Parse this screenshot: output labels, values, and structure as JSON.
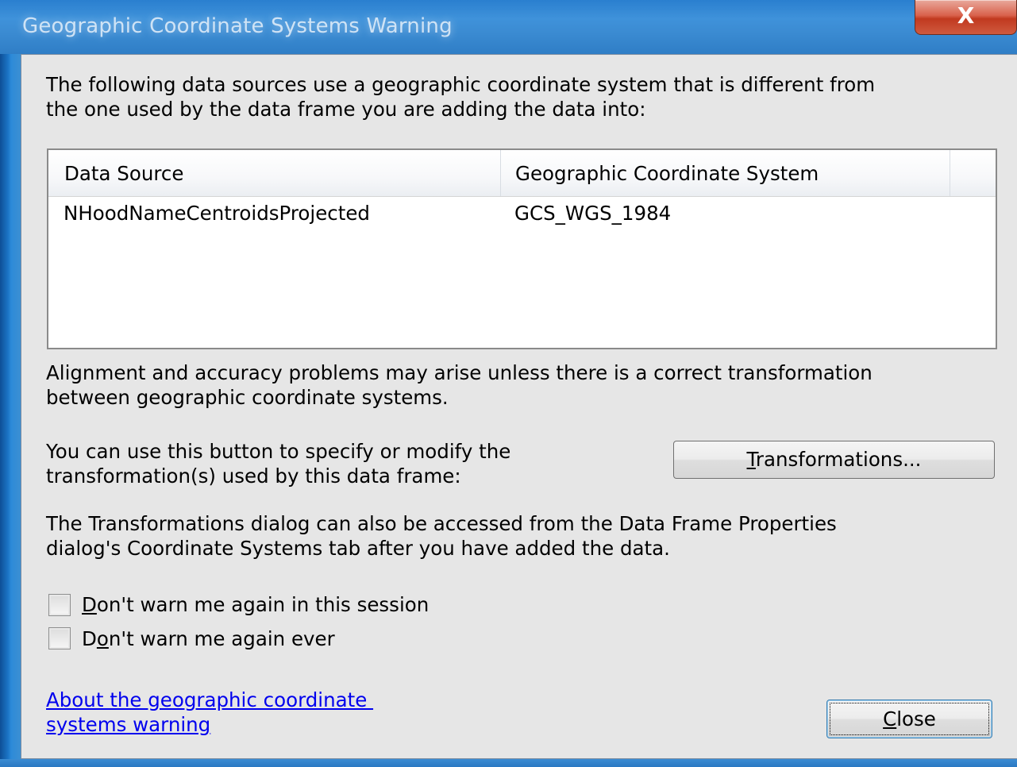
{
  "window": {
    "title": "Geographic Coordinate Systems Warning",
    "close_glyph": "X"
  },
  "intro": {
    "line1": "The following data sources use a geographic coordinate system that is different from",
    "line2": "the one used by the data frame you are adding the data into:"
  },
  "table": {
    "columns": [
      "Data Source",
      "Geographic Coordinate System"
    ],
    "rows": [
      {
        "data_source": "NHoodNameCentroidsProjected",
        "gcs": "GCS_WGS_1984"
      }
    ]
  },
  "alignment": {
    "line1": "Alignment and accuracy problems may arise unless there is a correct transformation",
    "line2": "between geographic coordinate systems."
  },
  "transform_hint": {
    "line1": "You can use this button to specify or modify the",
    "line2": "transformation(s) used by this data frame:"
  },
  "transformations_button": {
    "access_key": "T",
    "rest": "ransformations..."
  },
  "dialog_hint": {
    "line1": "The Transformations dialog can also be accessed from the Data Frame Properties",
    "line2": "dialog's Coordinate Systems tab after you have added the data."
  },
  "checkboxes": [
    {
      "pre": "",
      "key": "D",
      "post": "on't warn me again in this session",
      "checked": false
    },
    {
      "pre": "D",
      "key": "o",
      "post": "n't warn me again ever",
      "checked": false
    }
  ],
  "help_link": {
    "line1": "About the geographic coordinate ",
    "line2": "systems warning"
  },
  "close_button": {
    "access_key": "C",
    "rest": "lose"
  }
}
